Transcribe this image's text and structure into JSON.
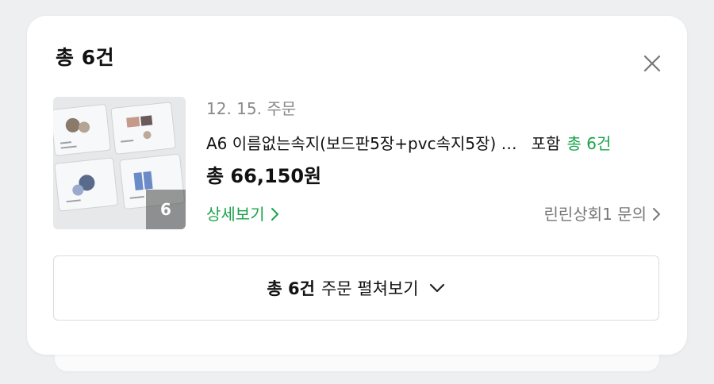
{
  "summary": {
    "title": "총 6건"
  },
  "order": {
    "date": "12. 15. 주문",
    "product_name": "A6 이름없는속지(보드판5장+pvc속지5장) …",
    "included_label": "포함",
    "included_count": "총 6건",
    "price": "총 66,150원",
    "detail_label": "상세보기",
    "seller_inquiry": "린린상회1 문의",
    "thumbnail_count": "6"
  },
  "expand": {
    "count": "총 6건",
    "label": "주문 펼쳐보기"
  },
  "colors": {
    "accent_green": "#1aa34a",
    "muted_text": "#8a8a8a",
    "background": "#eeeff1"
  },
  "icons": {
    "close": "close-icon",
    "detail_arrow": "chevron-right-icon",
    "seller_arrow": "chevron-right-icon",
    "expand_arrow": "chevron-down-icon"
  }
}
